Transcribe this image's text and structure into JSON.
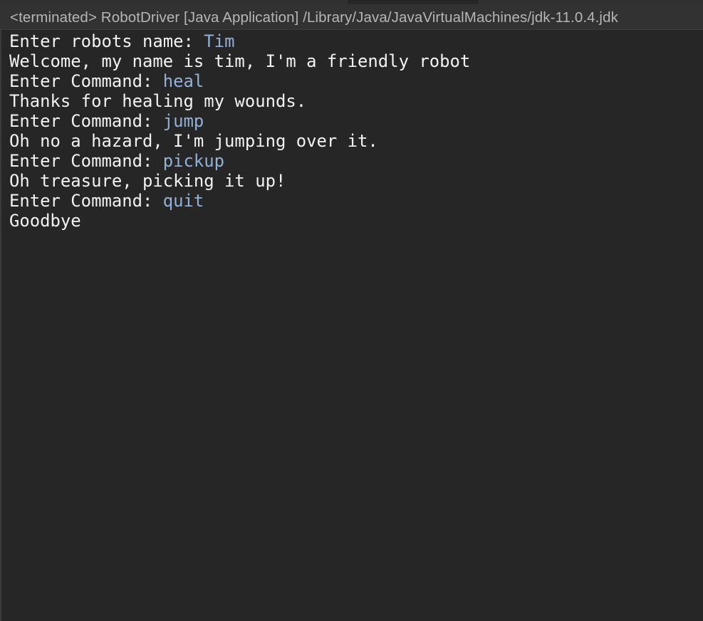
{
  "console": {
    "header": "<terminated> RobotDriver [Java Application] /Library/Java/JavaVirtualMachines/jdk-11.0.4.jdk",
    "lines": [
      {
        "prompt": "Enter robots name: ",
        "input": "Tim"
      },
      {
        "text": "Welcome, my name is tim, I'm a friendly robot"
      },
      {
        "prompt": "Enter Command: ",
        "input": "heal"
      },
      {
        "text": "Thanks for healing my wounds."
      },
      {
        "prompt": "Enter Command: ",
        "input": "jump"
      },
      {
        "text": "Oh no a hazard, I'm jumping over it."
      },
      {
        "prompt": "Enter Command: ",
        "input": "pickup"
      },
      {
        "text": "Oh treasure, picking it up!"
      },
      {
        "prompt": "Enter Command: ",
        "input": "quit"
      },
      {
        "text": "Goodbye"
      }
    ]
  },
  "colors": {
    "background": "#262626",
    "header_background": "#323232",
    "header_text": "#b6b6b6",
    "output_text": "#f2f2f2",
    "user_input": "#92b1d6"
  }
}
